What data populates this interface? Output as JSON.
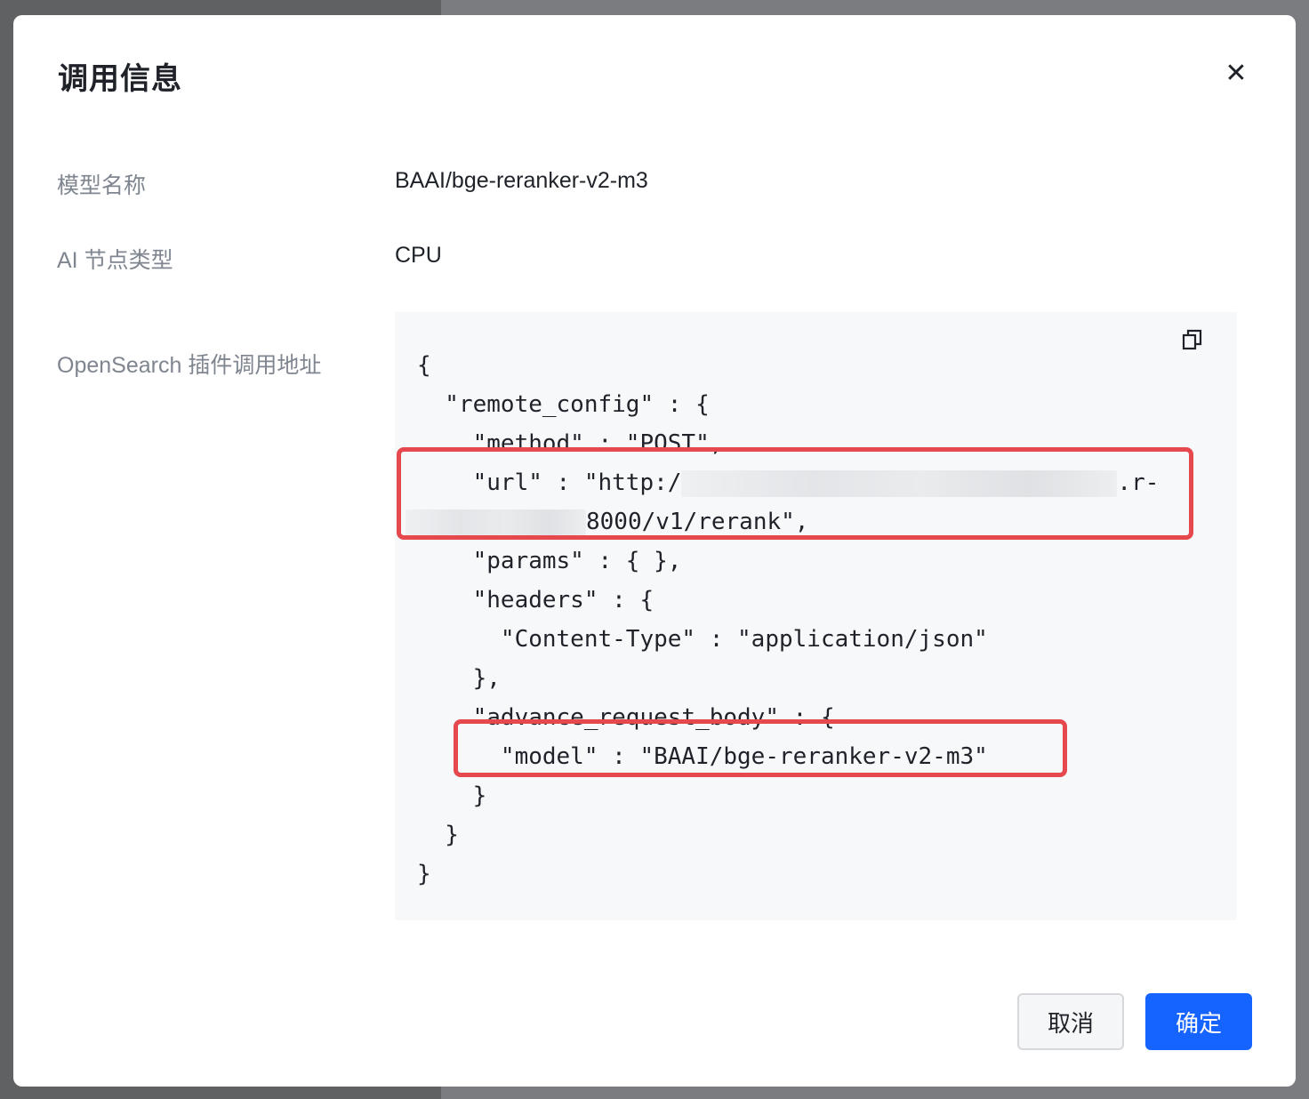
{
  "dialog": {
    "title": "调用信息",
    "close_icon": "close-icon"
  },
  "fields": [
    {
      "label": "模型名称",
      "value": "BAAI/bge-reranker-v2-m3"
    },
    {
      "label": "AI 节点类型",
      "value": "CPU"
    },
    {
      "label": "OpenSearch 插件调用地址"
    }
  ],
  "code": {
    "copy_icon": "copy-icon",
    "lines": [
      "{",
      "  \"remote_config\" : {",
      "    \"method\" : \"POST\",",
      "    \"url\" : \"http:/",
      ".r-",
      "8000/v1/rerank\",",
      "    \"params\" : { },",
      "    \"headers\" : {",
      "      \"Content-Type\" : \"application/json\"",
      "    },",
      "    \"advance_request_body\" : {",
      "      \"model\" : \"BAAI/bge-reranker-v2-m3\"",
      "    }",
      "  }",
      "}"
    ]
  },
  "footer": {
    "cancel_label": "取消",
    "ok_label": "确定"
  },
  "colors": {
    "primary": "#1664ff",
    "highlight_border": "#e5484d"
  }
}
